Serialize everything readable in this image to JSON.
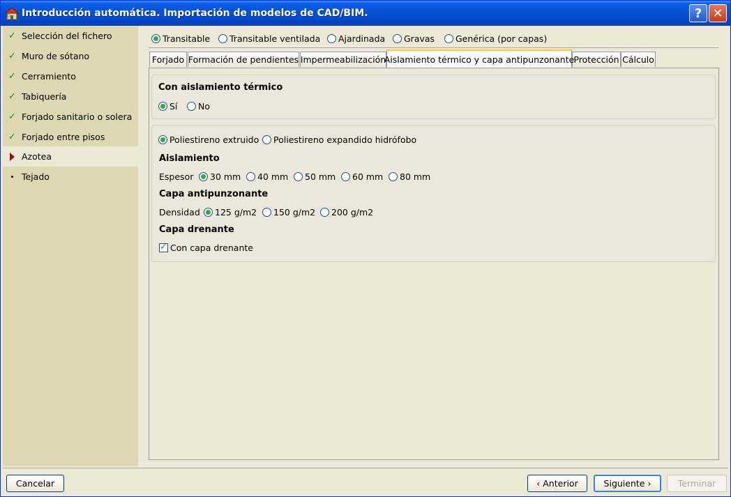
{
  "window": {
    "title": "Introducción automática. Importación de modelos de CAD/BIM.",
    "help_label": "?",
    "close_label": "✕"
  },
  "sidebar": {
    "items": [
      {
        "label": "Selección del fichero",
        "status": "done"
      },
      {
        "label": "Muro de sótano",
        "status": "done"
      },
      {
        "label": "Cerramiento",
        "status": "done"
      },
      {
        "label": "Tabiquería",
        "status": "done"
      },
      {
        "label": "Forjado sanitario o solera",
        "status": "done"
      },
      {
        "label": "Forjado entre pisos",
        "status": "done"
      },
      {
        "label": "Azotea",
        "status": "current"
      },
      {
        "label": "Tejado",
        "status": "pending"
      }
    ]
  },
  "roof_types": {
    "options": [
      "Transitable",
      "Transitable ventilada",
      "Ajardinada",
      "Gravas",
      "Genérica (por capas)"
    ],
    "selected": "Transitable"
  },
  "tabs": {
    "items": [
      "Forjado",
      "Formación de pendientes",
      "Impermeabilización",
      "Aislamiento térmico y capa antipunzonante",
      "Protección",
      "Cálculo"
    ],
    "selected": "Aislamiento térmico y capa antipunzonante"
  },
  "thermal": {
    "title": "Con aislamiento térmico",
    "options": [
      "Sí",
      "No"
    ],
    "selected": "Sí"
  },
  "material": {
    "options": [
      "Poliestireno extruido",
      "Poliestireno expandido hidrófobo"
    ],
    "selected": "Poliestireno extruido"
  },
  "insulation": {
    "title": "Aislamiento",
    "thickness_label": "Espesor",
    "options": [
      "30 mm",
      "40 mm",
      "50 mm",
      "60 mm",
      "80 mm"
    ],
    "selected": "30 mm"
  },
  "antipunch": {
    "title": "Capa antipunzonante",
    "density_label": "Densidad",
    "options": [
      "125 g/m2",
      "150 g/m2",
      "200 g/m2"
    ],
    "selected": "125 g/m2"
  },
  "drainage": {
    "title": "Capa drenante",
    "checkbox_label": "Con capa drenante",
    "checked": true
  },
  "footer": {
    "cancel": "Cancelar",
    "prev": "‹ Anterior",
    "next": "Siguiente ›",
    "finish": "Terminar"
  }
}
